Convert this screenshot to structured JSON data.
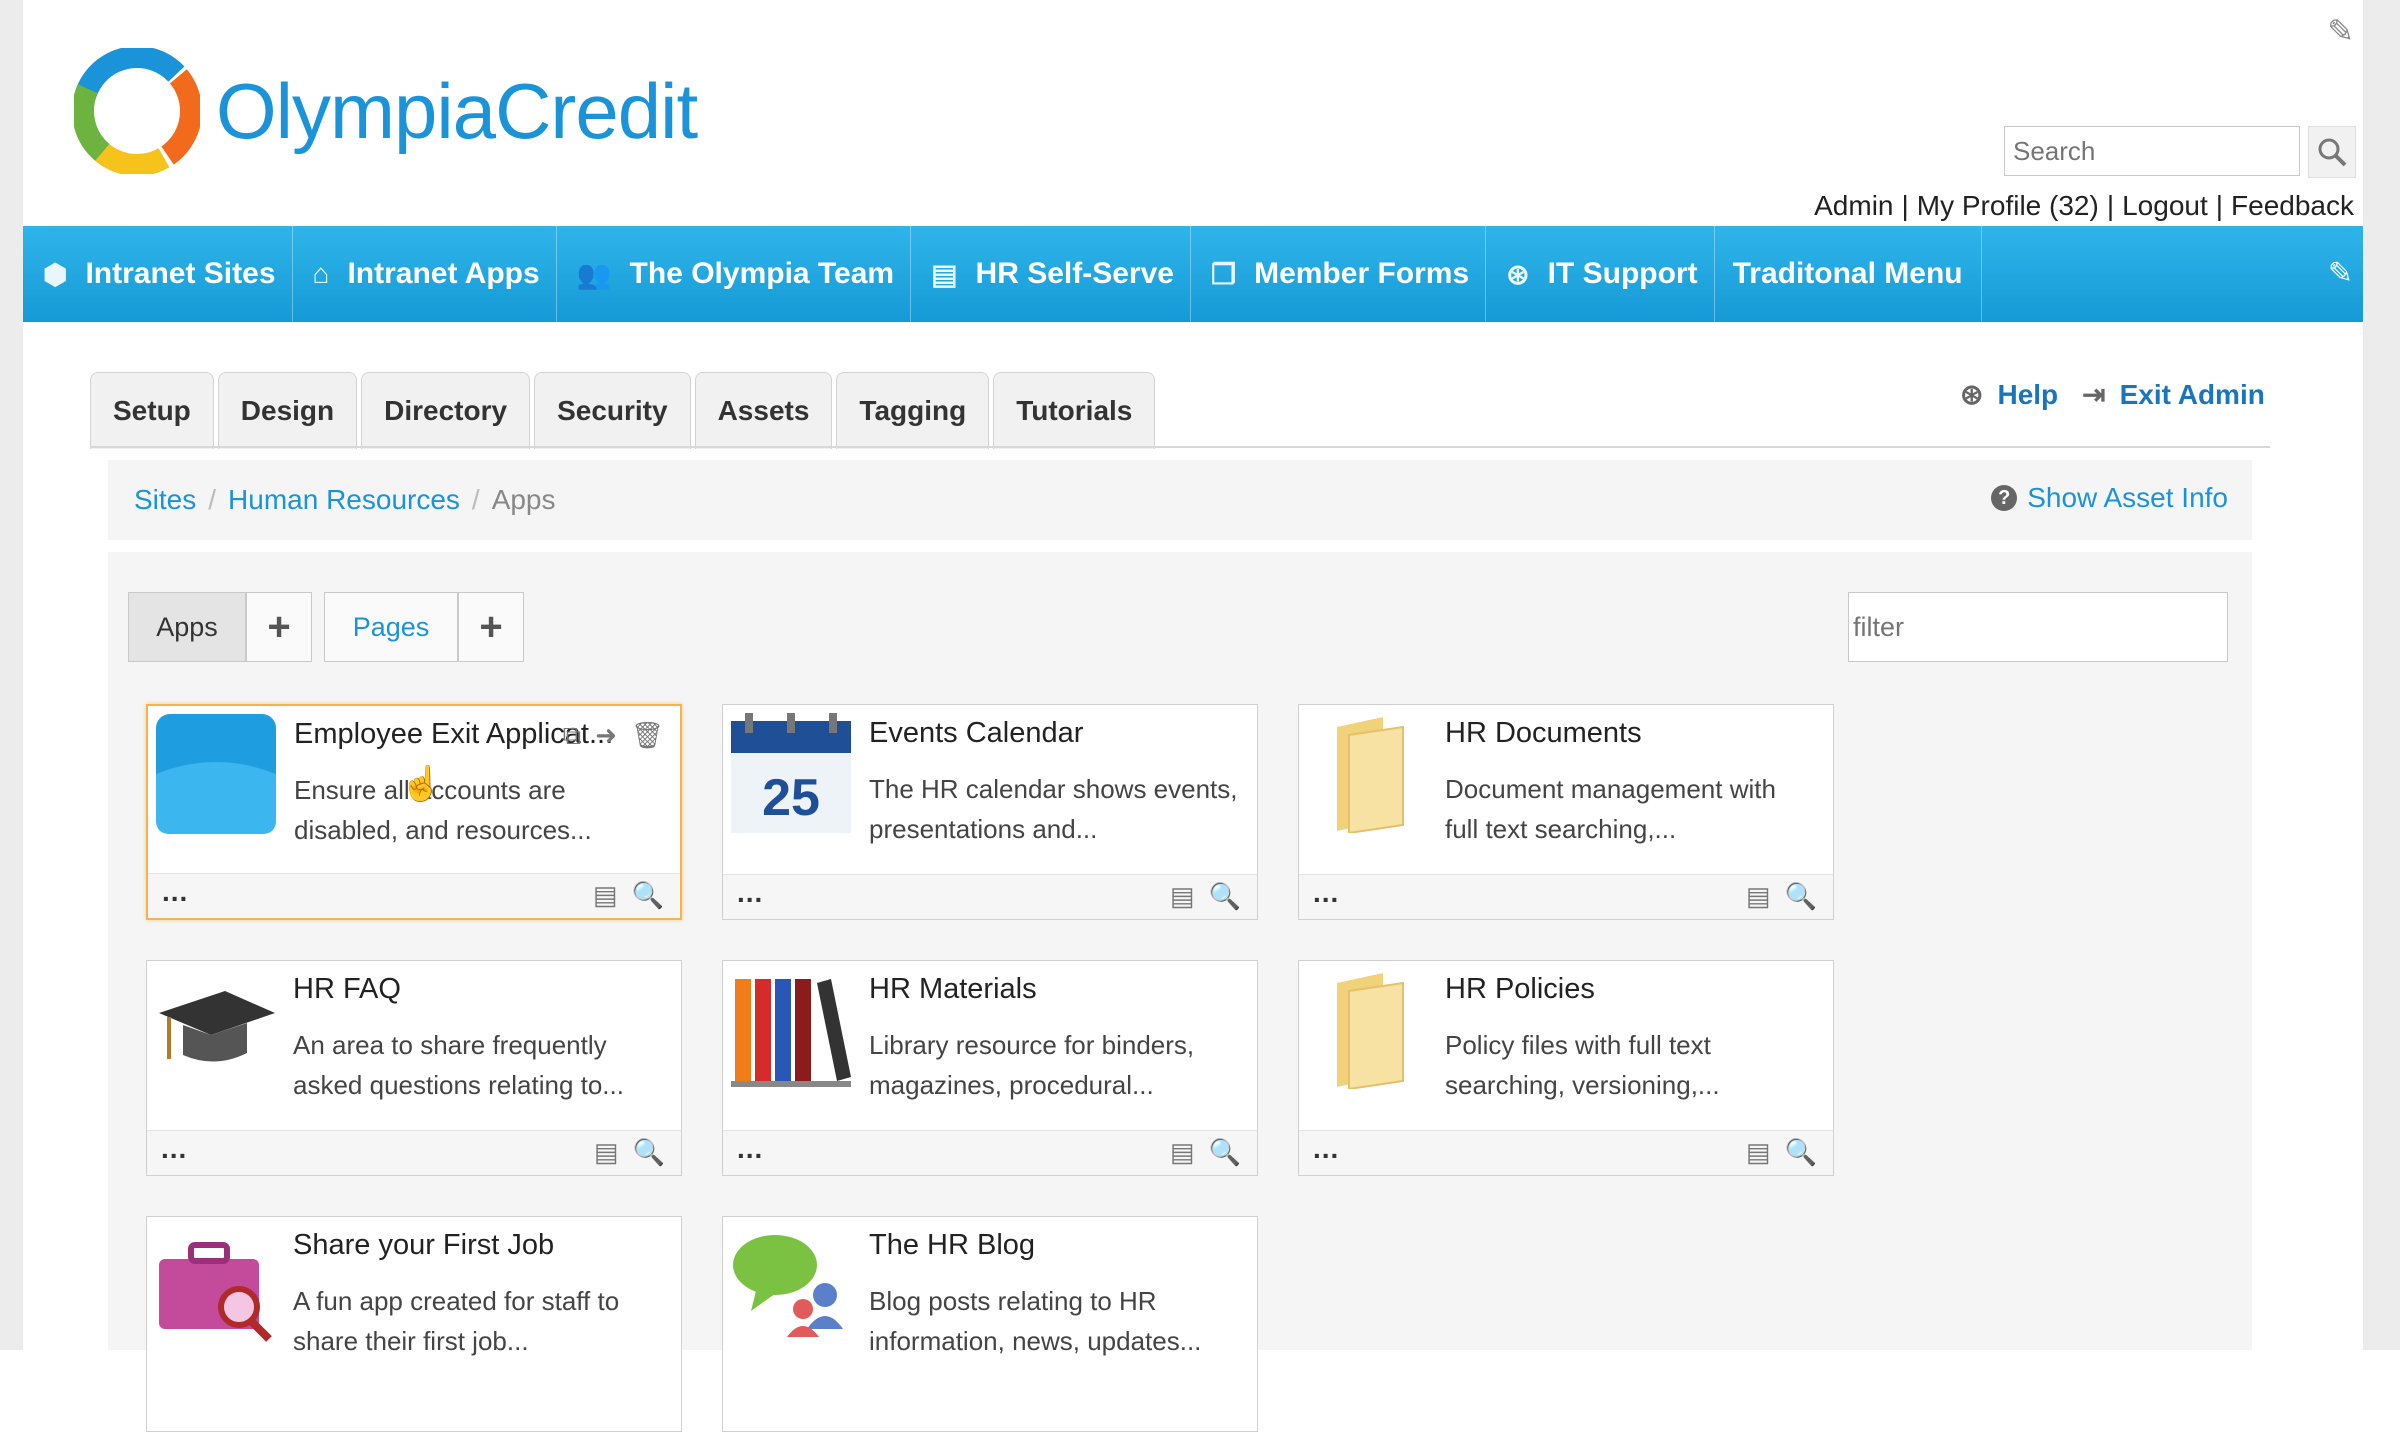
{
  "brand": {
    "name_part1": "Olympia",
    "name_part2": "Credit",
    "brand_color": "#1b93d8"
  },
  "search": {
    "placeholder": "Search"
  },
  "user_links": [
    "Admin",
    "My Profile (32)",
    "Logout",
    "Feedback"
  ],
  "nav": {
    "color": "#1da4de",
    "items": [
      {
        "label": "Intranet Sites",
        "icon": "cube-icon"
      },
      {
        "label": "Intranet Apps",
        "icon": "home-icon"
      },
      {
        "label": "The Olympia Team",
        "icon": "people-icon"
      },
      {
        "label": "HR Self-Serve",
        "icon": "form-icon"
      },
      {
        "label": "Member Forms",
        "icon": "documents-icon"
      },
      {
        "label": "IT Support",
        "icon": "lifebuoy-icon"
      },
      {
        "label": "Traditonal Menu",
        "icon": ""
      }
    ]
  },
  "admin_tabs": [
    "Setup",
    "Design",
    "Directory",
    "Security",
    "Assets",
    "Tagging",
    "Tutorials"
  ],
  "admin_links": {
    "help": "Help",
    "exit": "Exit Admin"
  },
  "breadcrumb": {
    "sites": "Sites",
    "section": "Human Resources",
    "current": "Apps",
    "asset_info": "Show Asset Info"
  },
  "toolbar": {
    "apps_label": "Apps",
    "pages_label": "Pages",
    "filter_placeholder": "filter"
  },
  "apps": [
    {
      "title": "Employee Exit Applicat...",
      "desc": "Ensure all accounts are disabled, and resources...",
      "icon": "blue-app-icon",
      "selected": true
    },
    {
      "title": "Events Calendar",
      "desc": "The HR calendar shows events, presentations and...",
      "icon": "calendar-icon",
      "calendar_day": "25"
    },
    {
      "title": "HR Documents",
      "desc": "Document management with full text searching,...",
      "icon": "folder-icon"
    },
    {
      "title": "HR FAQ",
      "desc": "An area to share frequently asked questions relating to...",
      "icon": "graduation-cap-icon"
    },
    {
      "title": "HR Materials",
      "desc": "Library resource for binders, magazines, procedural...",
      "icon": "binders-icon"
    },
    {
      "title": "HR Policies",
      "desc": "Policy files with full text searching, versioning,...",
      "icon": "folder-icon"
    },
    {
      "title": "Share your First Job",
      "desc": "A fun app created for staff to share their first job...",
      "icon": "briefcase-search-icon"
    },
    {
      "title": "The HR Blog",
      "desc": "Blog posts relating to HR information, news, updates...",
      "icon": "chat-people-icon"
    }
  ],
  "card_more": "..."
}
